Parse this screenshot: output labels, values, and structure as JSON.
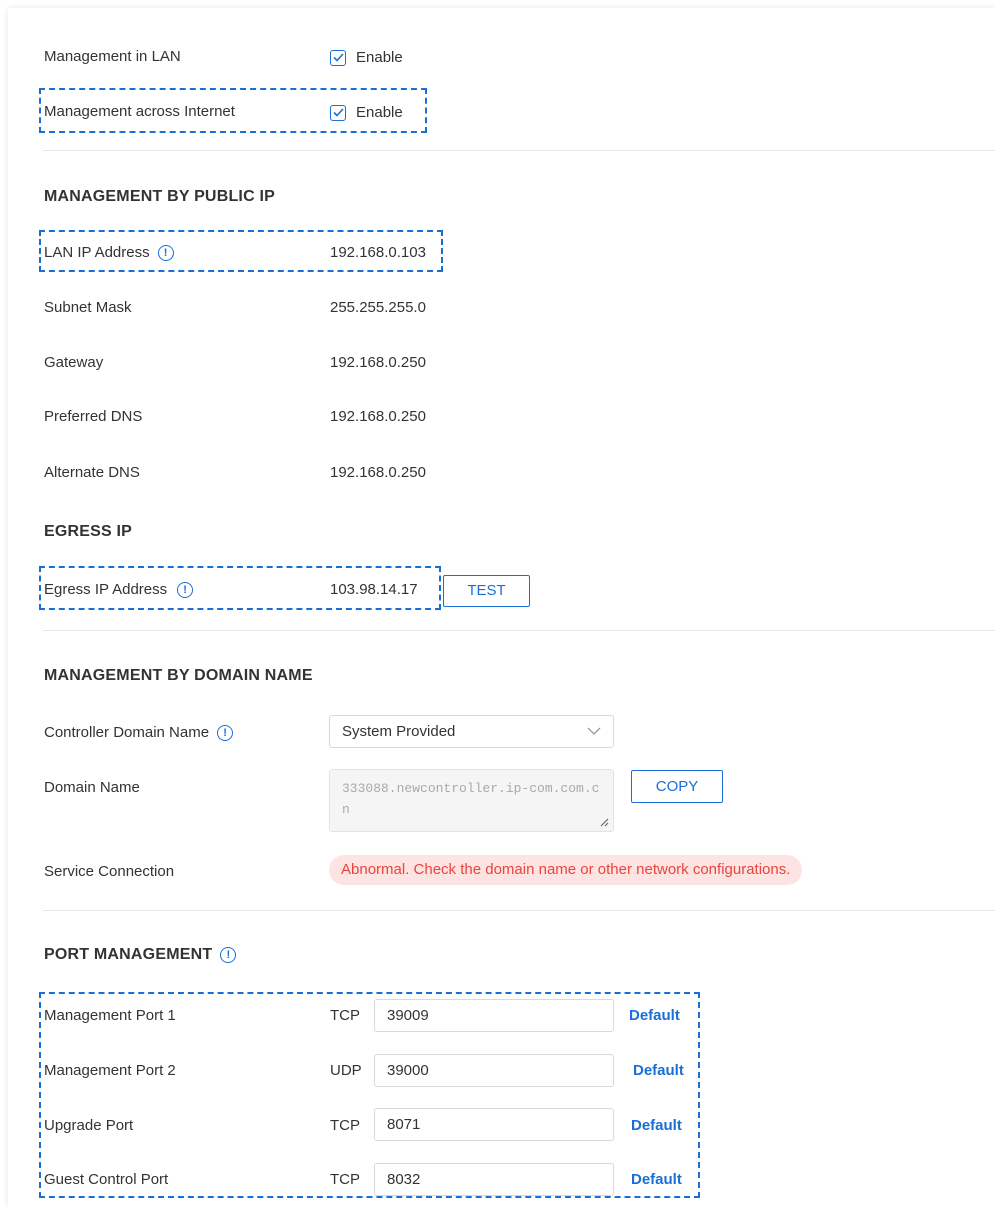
{
  "management": {
    "lan_label": "Management in LAN",
    "lan_enable": "Enable",
    "internet_label": "Management across Internet",
    "internet_enable": "Enable"
  },
  "public_ip": {
    "heading": "MANAGEMENT BY PUBLIC IP",
    "rows": [
      {
        "label": "LAN IP Address",
        "value": "192.168.0.103"
      },
      {
        "label": "Subnet Mask",
        "value": "255.255.255.0"
      },
      {
        "label": "Gateway",
        "value": "192.168.0.250"
      },
      {
        "label": "Preferred DNS",
        "value": "192.168.0.250"
      },
      {
        "label": "Alternate DNS",
        "value": "192.168.0.250"
      }
    ]
  },
  "egress": {
    "heading": "EGRESS IP",
    "label": "Egress IP Address",
    "value": "103.98.14.17",
    "test_button": "TEST"
  },
  "domain": {
    "heading": "MANAGEMENT BY DOMAIN NAME",
    "controller_label": "Controller Domain Name",
    "controller_selected": "System Provided",
    "domain_label": "Domain Name",
    "domain_value": "333088.newcontroller.ip-com.com.cn",
    "copy_button": "COPY",
    "service_label": "Service Connection",
    "service_status": "Abnormal. Check the domain name or other network configurations."
  },
  "ports": {
    "heading": "PORT MANAGEMENT",
    "rows": [
      {
        "label": "Management Port 1",
        "protocol": "TCP",
        "value": "39009",
        "default_label": "Default"
      },
      {
        "label": "Management Port 2",
        "protocol": "UDP",
        "value": "39000",
        "default_label": "Default"
      },
      {
        "label": "Upgrade Port",
        "protocol": "TCP",
        "value": "8071",
        "default_label": "Default"
      },
      {
        "label": "Guest Control Port",
        "protocol": "TCP",
        "value": "8032",
        "default_label": "Default"
      }
    ]
  },
  "colors": {
    "accent": "#1a6fd6",
    "error_text": "#e8453c",
    "error_bg": "#fde4e2"
  }
}
